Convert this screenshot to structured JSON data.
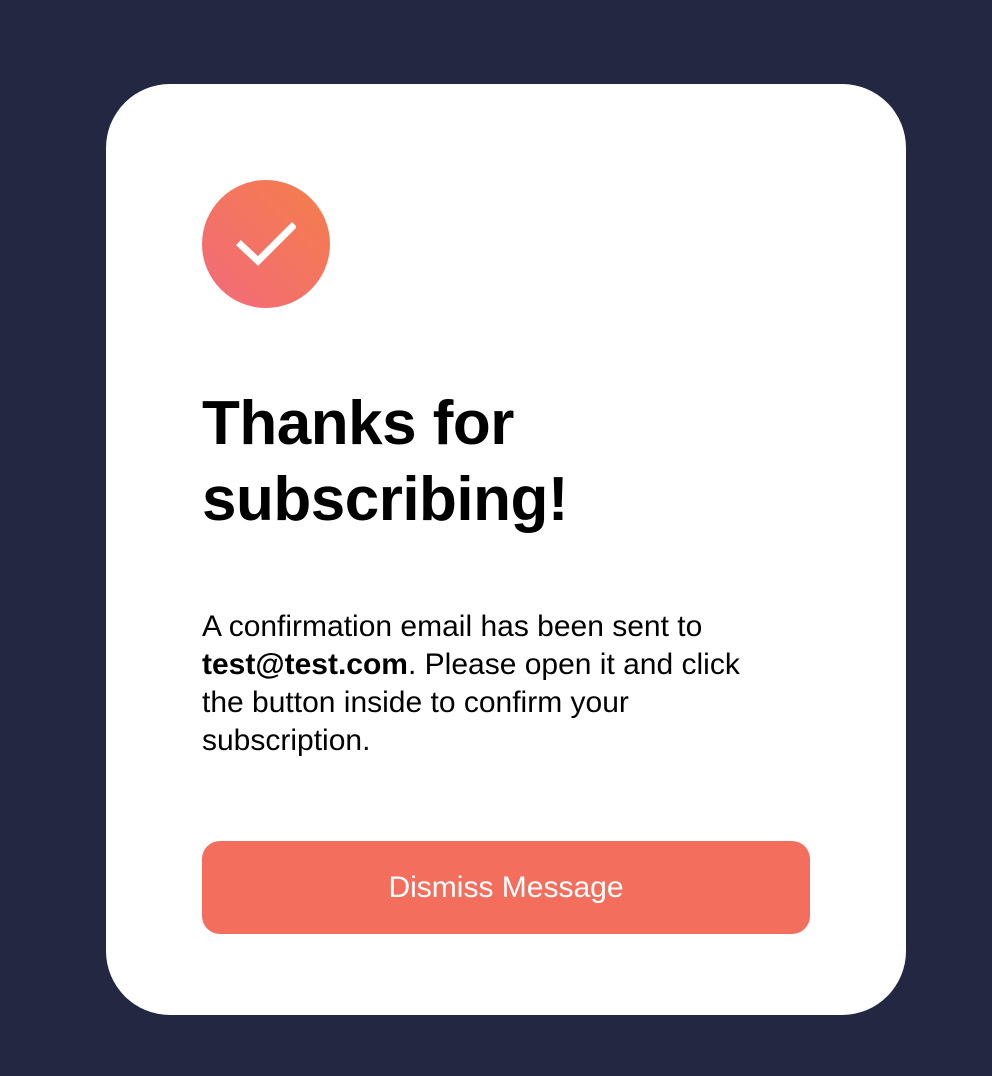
{
  "colors": {
    "page_background": "#242742",
    "card_background": "#ffffff",
    "accent": "#f46e5e",
    "badge_gradient_start": "#f57e4a",
    "badge_gradient_end": "#f26a7b"
  },
  "icon": "checkmark-icon",
  "success": {
    "title": "Thanks for subscribing!",
    "message_prefix": "A confirmation email has been sent to ",
    "email": "test@test.com",
    "message_suffix": ". Please open it and click the button inside to confirm your subscription."
  },
  "actions": {
    "dismiss_label": "Dismiss Message"
  }
}
